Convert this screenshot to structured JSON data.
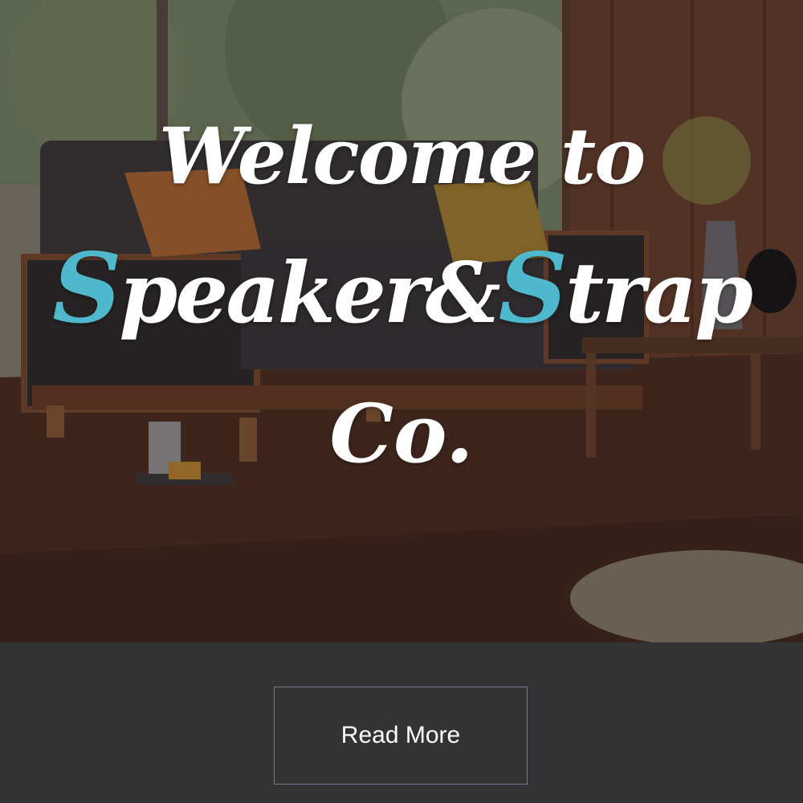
{
  "hero": {
    "title_line1": "Welcome to",
    "title_line2_a": "S",
    "title_line2_b": "peaker&",
    "title_line2_c": "S",
    "title_line2_d": "trap",
    "title_line3": "Co.",
    "accent_color": "#4fb8cc",
    "background_image": "living-room-photo"
  },
  "cta": {
    "label": "Read More"
  }
}
